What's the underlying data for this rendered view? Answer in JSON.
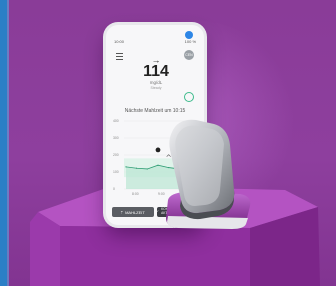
{
  "phone": {
    "status_time": "10:00",
    "status_battery": "100 %",
    "avatar_initials": "CEN",
    "trend_arrow": "→",
    "glucose_value": "114",
    "glucose_unit": "mg/dL",
    "glucose_sub": "Steady",
    "next_meal": "Nächste Mahlzeit um 10:15",
    "button_manual": "MAHLZEIT",
    "button_auto": "KOHLENHYDRATE AKTIVIEREN"
  },
  "chart_data": {
    "type": "area",
    "y_ticks": [
      "400",
      "300",
      "200",
      "100",
      "0"
    ],
    "x_ticks": [
      "8:00",
      "9:00",
      "10:00"
    ],
    "ylim": [
      0,
      400
    ],
    "series": [
      {
        "values": [
          130,
          122,
          118,
          140,
          126,
          118,
          114
        ]
      }
    ],
    "target_range": [
      70,
      180
    ]
  },
  "colors": {
    "background": "#8a3c98",
    "accent_green": "#3dbb8c",
    "pedestal_top": "#b453c2",
    "pedestal_side": "#8f2f9e"
  }
}
